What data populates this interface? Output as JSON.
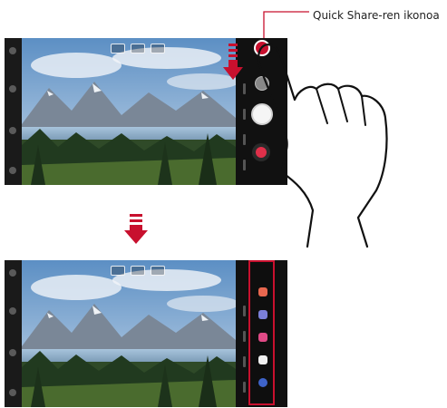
{
  "callout": {
    "label": "Quick Share-ren ikonoa"
  },
  "colors": {
    "accent": "#c8102e",
    "screen_bg": "#151515"
  },
  "icons": {
    "quick_share": "quick-share-icon",
    "shutter": "shutter-button",
    "record": "record-button",
    "share_targets": [
      "app-icon-1",
      "app-icon-2",
      "app-icon-3",
      "app-icon-4",
      "app-icon-5"
    ]
  }
}
